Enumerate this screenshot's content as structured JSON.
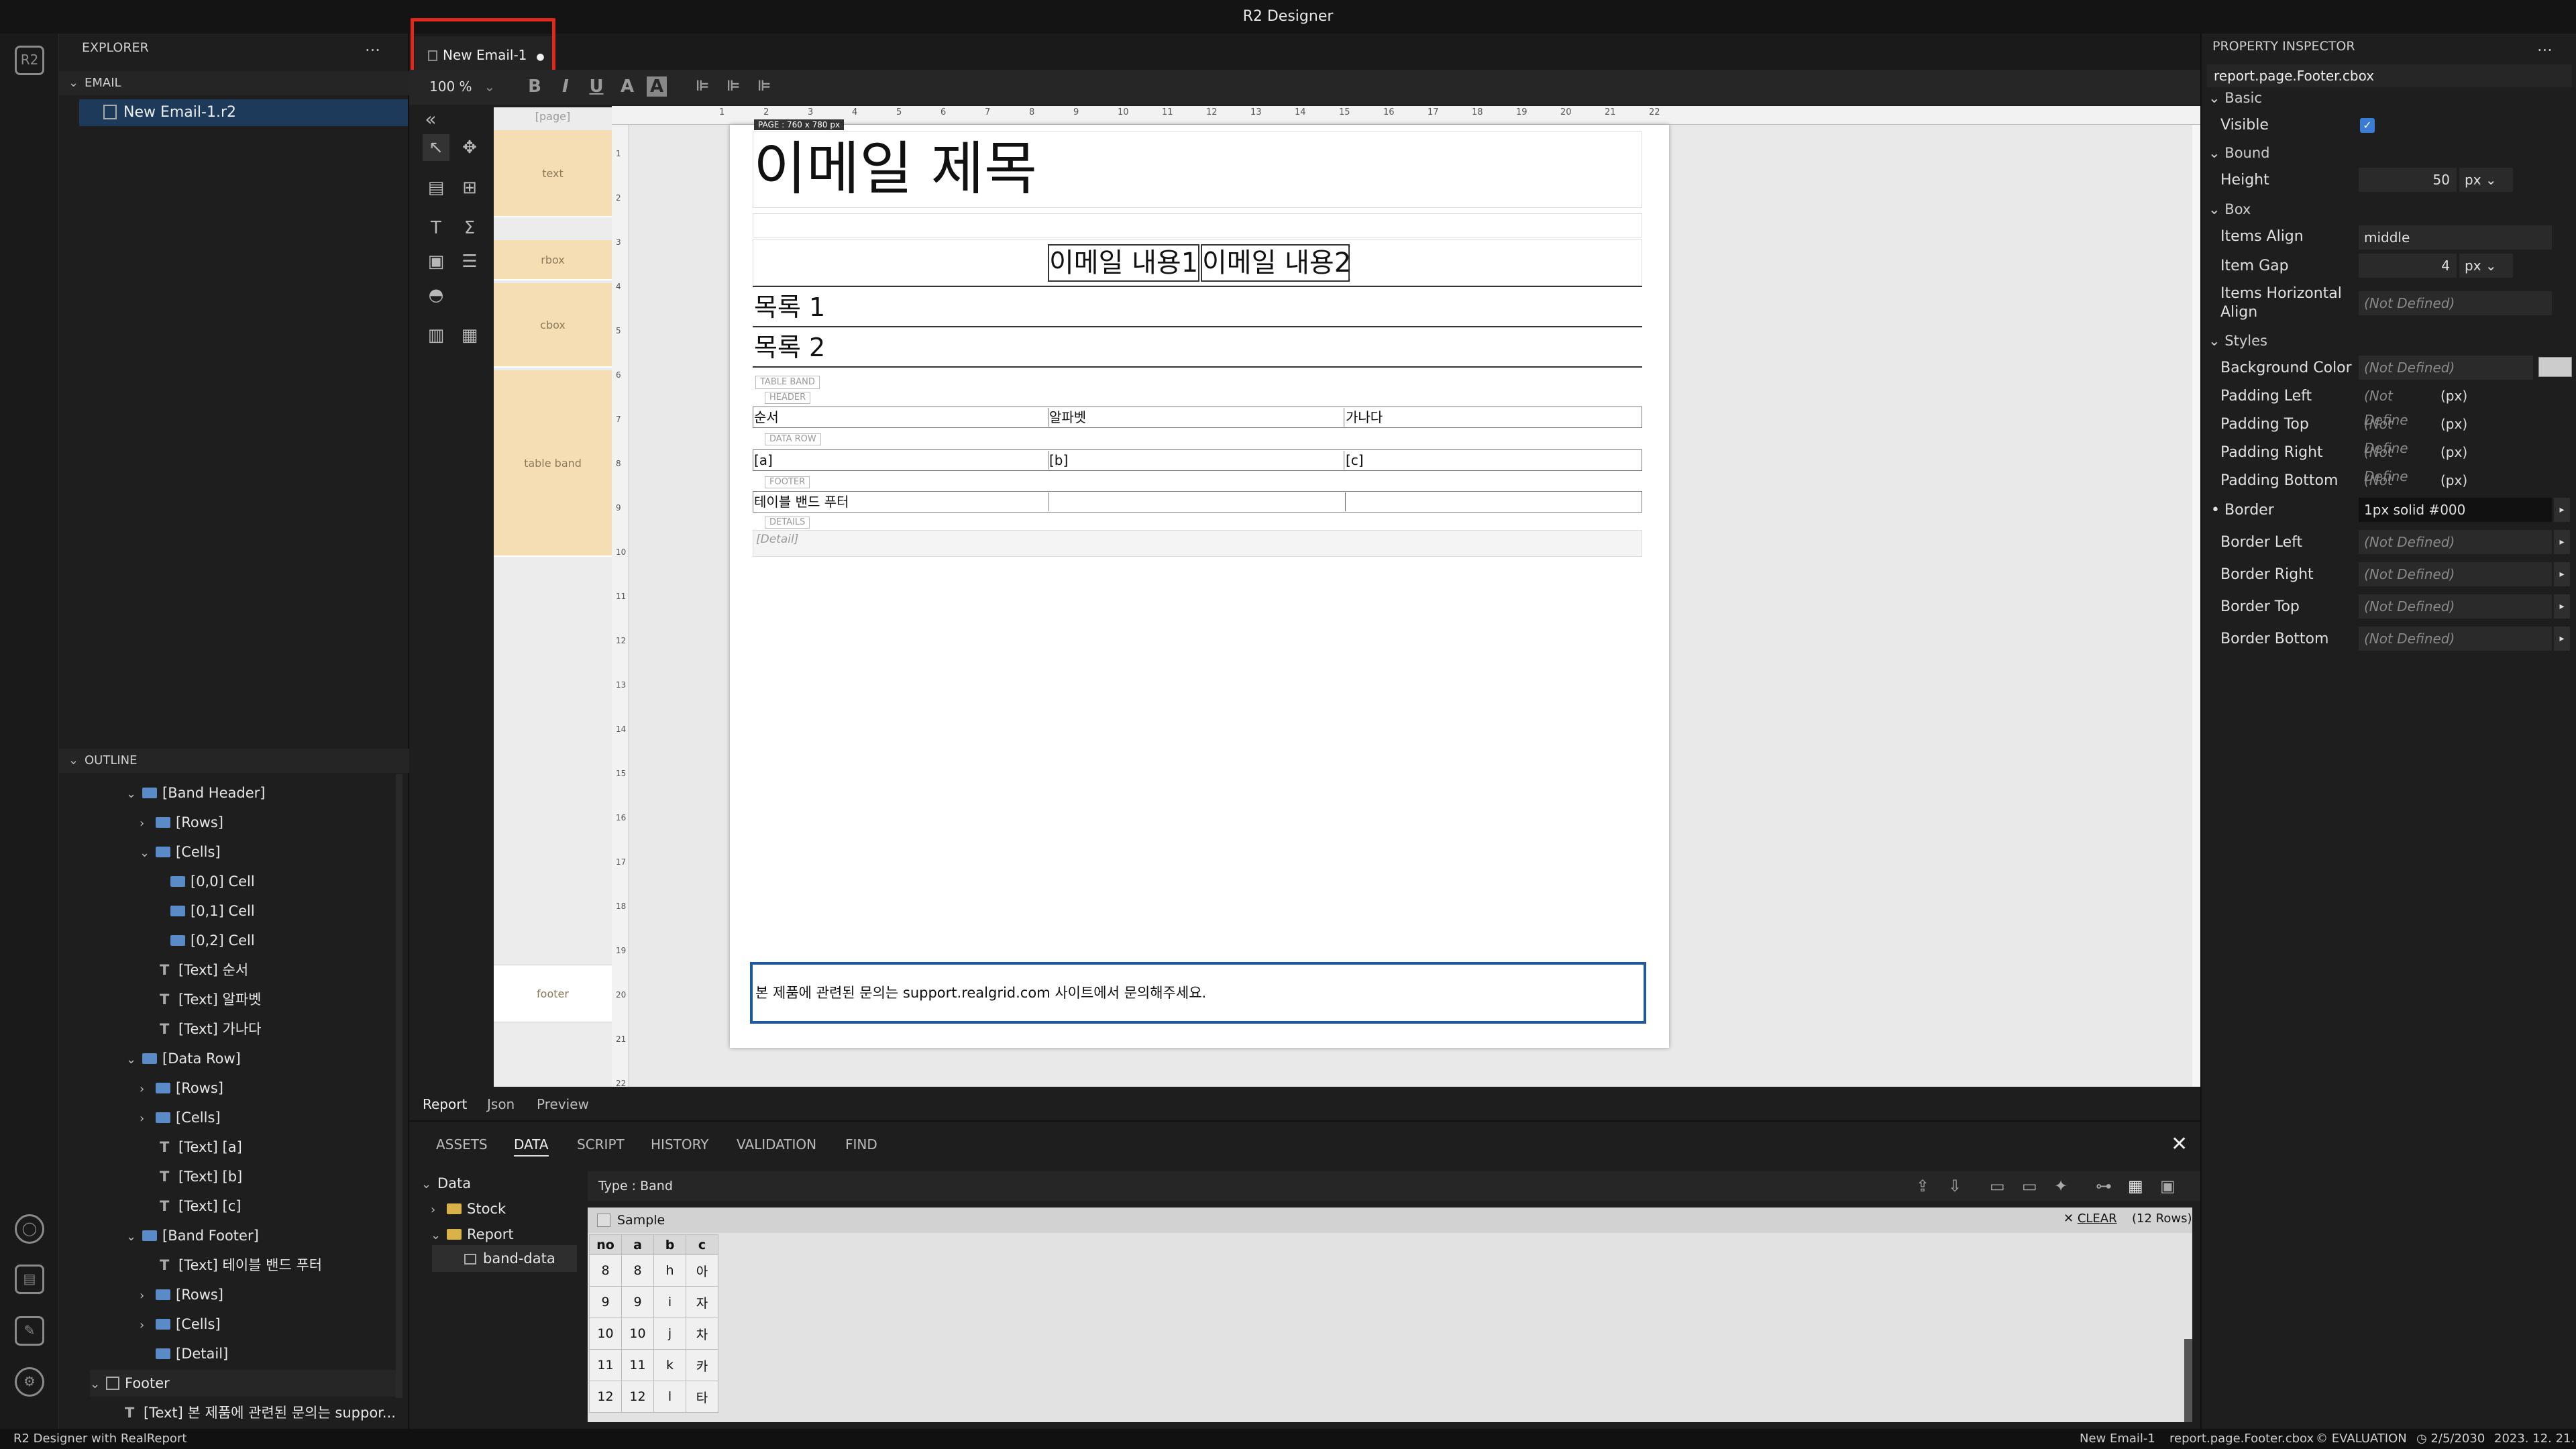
{
  "app": {
    "title": "R2 Designer"
  },
  "explorer": {
    "title": "EXPLORER",
    "more": "...",
    "section": "EMAIL",
    "file": "New Email-1.r2"
  },
  "outline": {
    "title": "OUTLINE",
    "items": [
      "[Band Header]",
      "[Rows]",
      "[Cells]",
      "[0,0] Cell",
      "[0,1] Cell",
      "[0,2] Cell",
      "[Text] 순서",
      "[Text] 알파벳",
      "[Text] 가나다",
      "[Data Row]",
      "[Rows]",
      "[Cells]",
      "[Text] [a]",
      "[Text] [b]",
      "[Text] [c]",
      "[Band Footer]",
      "[Text] 테이블 밴드 푸터",
      "[Rows]",
      "[Cells]",
      "[Detail]",
      "Footer",
      "[Text] 본 제품에 관련된 문의는 suppor..."
    ]
  },
  "editor": {
    "tab": "New Email-1",
    "zoom": "100 %",
    "modified_dot": "●"
  },
  "toolbar": {
    "bold": "B",
    "italic": "I",
    "underline": "U",
    "fontcolor": "A",
    "bgcolor": "A"
  },
  "bands": {
    "page": "[page]",
    "text": "text",
    "rbox": "rbox",
    "cbox": "cbox",
    "table_band": "table band",
    "footer": "footer"
  },
  "ruler": {
    "h": [
      "1",
      "2",
      "3",
      "4",
      "5",
      "6",
      "7",
      "8",
      "9",
      "10",
      "11",
      "12",
      "13",
      "14",
      "15",
      "16",
      "17",
      "18",
      "19",
      "20",
      "21",
      "22"
    ],
    "v": [
      "1",
      "2",
      "3",
      "4",
      "5",
      "6",
      "7",
      "8",
      "9",
      "10",
      "11",
      "12",
      "13",
      "14",
      "15",
      "16",
      "17",
      "18",
      "19",
      "20",
      "21",
      "22"
    ]
  },
  "report": {
    "page_tag": "PAGE : 760 x 780 px",
    "title": "이메일 제목",
    "content1": "이메일 내용1",
    "content2": "이메일 내용2",
    "list1": "목록 1",
    "list2": "목록 2",
    "table_band": "TABLE BAND",
    "header": "HEADER",
    "h1": "순서",
    "h2": "알파벳",
    "h3": "가나다",
    "data_row": "DATA ROW",
    "d1": "[a]",
    "d2": "[b]",
    "d3": "[c]",
    "footer": "FOOTER",
    "footer_text": "테이블 밴드 푸터",
    "details": "DETAILS",
    "detail": "[Detail]",
    "page_footer": "본 제품에 관련된 문의는 support.realgrid.com 사이트에서 문의해주세요."
  },
  "inspector": {
    "title": "PROPERTY INSPECTOR",
    "more": "...",
    "path": "report.page.Footer.cbox",
    "basic": "Basic",
    "visible": "Visible",
    "bound": "Bound",
    "height": "Height",
    "height_val": "50",
    "unit": "px",
    "box": "Box",
    "items_align": "Items Align",
    "items_align_val": "middle",
    "item_gap": "Item Gap",
    "item_gap_val": "4",
    "items_h_align": "Items Horizontal Align",
    "nd": "(Not Defined)",
    "nd_short": "(Not Define",
    "px": "(px)",
    "styles": "Styles",
    "bg": "Background Color",
    "pl": "Padding Left",
    "pt": "Padding Top",
    "pr": "Padding Right",
    "pb": "Padding Bottom",
    "border": "Border",
    "border_val": "1px solid #000",
    "bl": "Border Left",
    "br": "Border Right",
    "btp": "Border Top",
    "bb": "Border Bottom"
  },
  "view_tabs": [
    "Report",
    "Json",
    "Preview"
  ],
  "panel_tabs": [
    "ASSETS",
    "DATA",
    "SCRIPT",
    "HISTORY",
    "VALIDATION",
    "FIND"
  ],
  "data_tree": [
    "Data",
    "Stock",
    "Report",
    "band-data"
  ],
  "data": {
    "type": "Type : Band",
    "sample": "Sample",
    "clear": "CLEAR",
    "rows": "(12 Rows)",
    "cols": [
      "no",
      "a",
      "b",
      "c"
    ],
    "rows_data": [
      [
        "8",
        "8",
        "h",
        "아"
      ],
      [
        "9",
        "9",
        "i",
        "자"
      ],
      [
        "10",
        "10",
        "j",
        "차"
      ],
      [
        "11",
        "11",
        "k",
        "카"
      ],
      [
        "12",
        "12",
        "l",
        "타"
      ]
    ]
  },
  "status": {
    "left": "R2 Designer with RealReport",
    "file": "New Email-1",
    "path": "report.page.Footer.cbox",
    "eval": "EVALUATION",
    "date1": "2/5/2030",
    "date2": "2023. 12. 21."
  }
}
